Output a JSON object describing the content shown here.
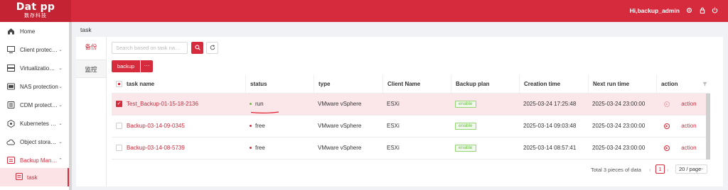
{
  "header": {
    "logo_main": "Dat pp",
    "logo_sub": "数存科技",
    "user_greeting": "Hi,backup_admin",
    "icons": [
      "gear-icon",
      "lock-icon",
      "power-icon"
    ],
    "accent_color": "#d52b3c"
  },
  "sidebar": {
    "items": [
      {
        "label": "Home",
        "icon": "home-icon",
        "expandable": false
      },
      {
        "label": "Client protec…",
        "icon": "client-icon",
        "expandable": true
      },
      {
        "label": "Virtualizatio…",
        "icon": "virtualization-icon",
        "expandable": true
      },
      {
        "label": "NAS protection",
        "icon": "nas-icon",
        "expandable": true
      },
      {
        "label": "CDM protect…",
        "icon": "cdm-icon",
        "expandable": true
      },
      {
        "label": "Kubernetes …",
        "icon": "kubernetes-icon",
        "expandable": true
      },
      {
        "label": "Object stora…",
        "icon": "cloud-icon",
        "expandable": true
      },
      {
        "label": "Backup Man…",
        "icon": "backup-manager-icon",
        "expandable": true,
        "expanded": true
      }
    ],
    "sub_item": {
      "label": "task",
      "icon": "task-icon"
    }
  },
  "breadcrumb": "task",
  "tabs": {
    "backup": "备份",
    "monitor": "监控"
  },
  "toolbar": {
    "search_placeholder": "Search based on task na…",
    "backup_button": "backup",
    "more_button": "···"
  },
  "table": {
    "columns": [
      "task name",
      "status",
      "type",
      "Client Name",
      "Backup plan",
      "Creation time",
      "Next run time",
      "action"
    ],
    "rows": [
      {
        "name": "Test_Backup-01-15-18-2136",
        "status": "run",
        "status_color": "#67c23a",
        "type": "VMware vSphere",
        "client": "ESXi",
        "plan": "enable",
        "created": "2025-03-24 17:25:48",
        "next_run": "2025-03-24 23:00:00",
        "action": "action",
        "selected": true
      },
      {
        "name": "Backup-03-14-09-0345",
        "status": "free",
        "status_color": "#d52b3c",
        "type": "VMware vSphere",
        "client": "ESXi",
        "plan": "enable",
        "created": "2025-03-14 09:03:48",
        "next_run": "2025-03-24 23:00:00",
        "action": "action",
        "selected": false
      },
      {
        "name": "Backup-03-14-08-5739",
        "status": "free",
        "status_color": "#d52b3c",
        "type": "VMware vSphere",
        "client": "ESXi",
        "plan": "enable",
        "created": "2025-03-14 08:57:41",
        "next_run": "2025-03-24 23:00:00",
        "action": "action",
        "selected": false
      }
    ]
  },
  "pagination": {
    "total": "Total 3 pieces of data",
    "current_page": "1",
    "page_size": "20 / page"
  }
}
